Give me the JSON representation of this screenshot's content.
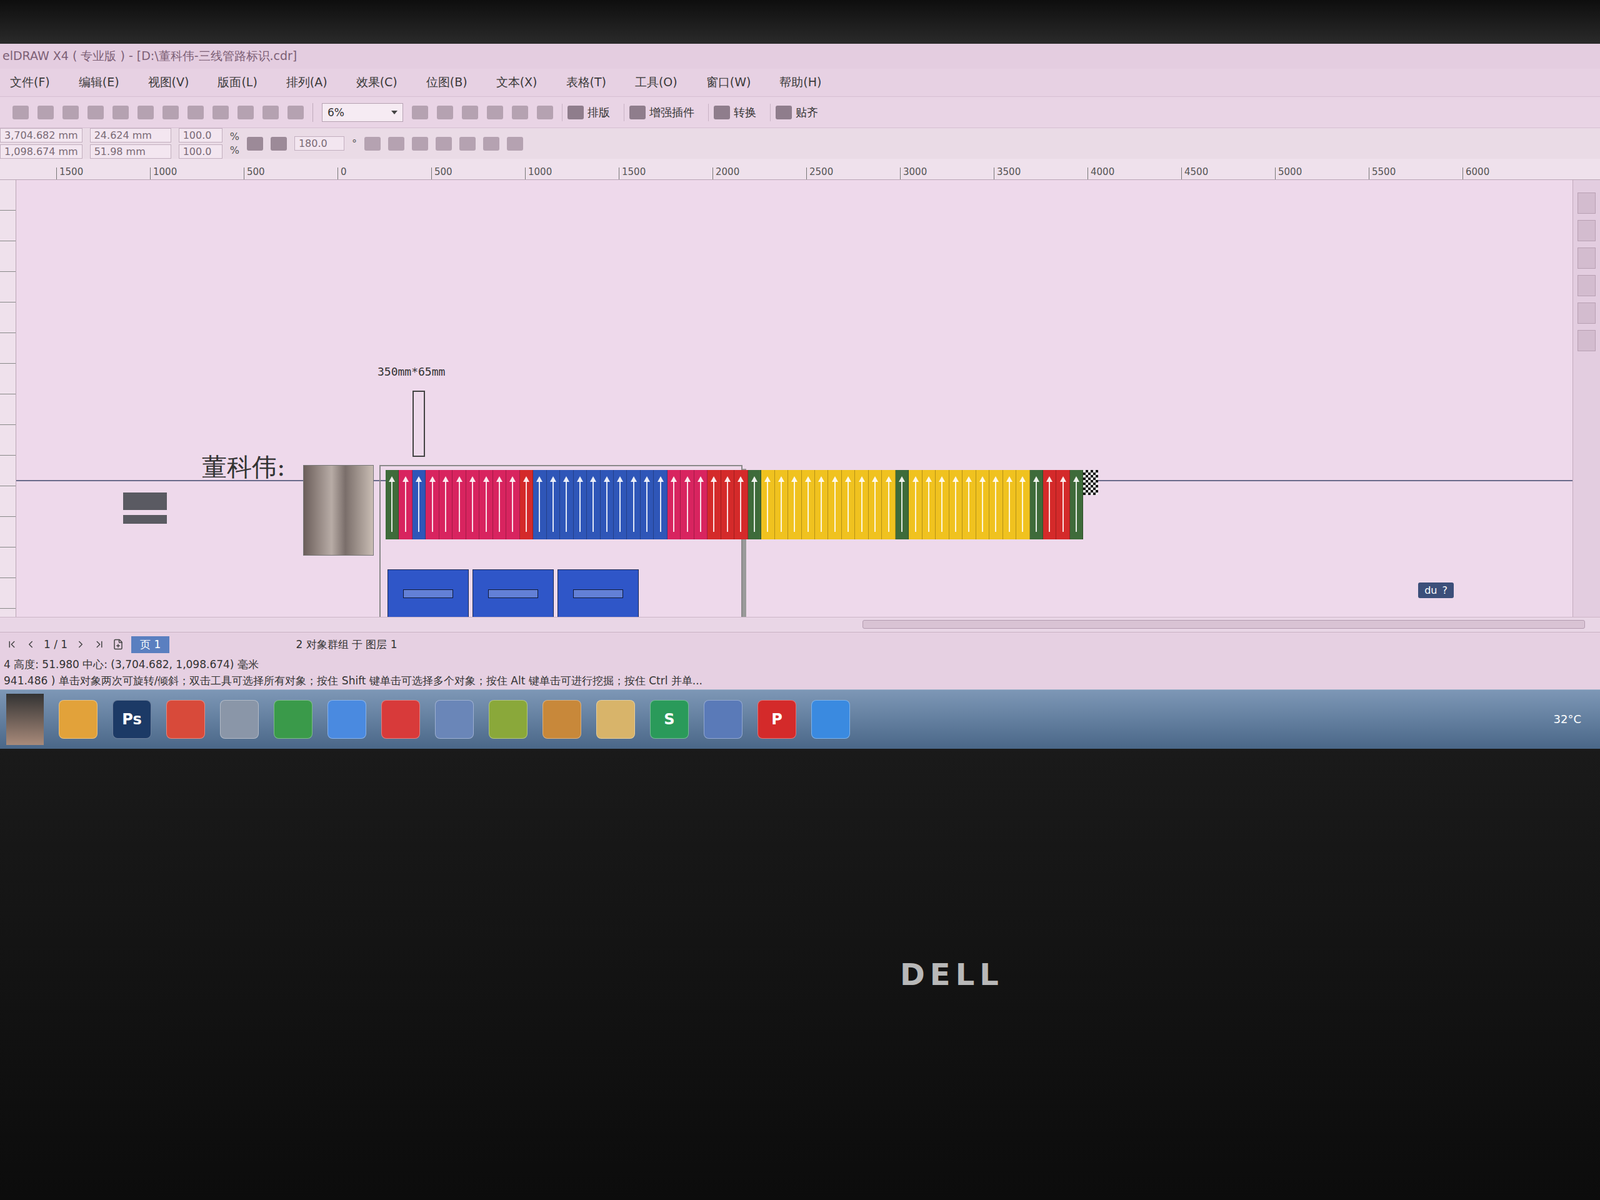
{
  "window": {
    "title": "elDRAW X4 ( 专业版 ) - [D:\\董科伟-三线管路标识.cdr]"
  },
  "menu": [
    "文件(F)",
    "编辑(E)",
    "视图(V)",
    "版面(L)",
    "排列(A)",
    "效果(C)",
    "位图(B)",
    "文本(X)",
    "表格(T)",
    "工具(O)",
    "窗口(W)",
    "帮助(H)"
  ],
  "toolbar": {
    "zoom": "6%",
    "buttons": [
      "排版",
      "增强插件",
      "转换",
      "贴齐"
    ]
  },
  "property_bar": {
    "x": "3,704.682 mm",
    "y": "1,098.674 mm",
    "width": "24.624 mm",
    "height": "51.98 mm",
    "scale_x": "100.0",
    "scale_y": "100.0",
    "percent": "%",
    "rotation": "180.0",
    "degree": "°"
  },
  "ruler": [
    "1500",
    "1000",
    "500",
    "0",
    "500",
    "1000",
    "1500",
    "2000",
    "2500",
    "3000",
    "3500",
    "4000",
    "4500",
    "5000",
    "5500",
    "6000"
  ],
  "canvas": {
    "dimension_label": "350mm*65mm",
    "name_label": "董科伟:",
    "strip": [
      {
        "color": "#3e6b3a"
      },
      {
        "color": "#d8245f"
      },
      {
        "color": "#2f56b8"
      },
      {
        "color": "#d8245f"
      },
      {
        "color": "#d8245f"
      },
      {
        "color": "#d8245f"
      },
      {
        "color": "#d8245f"
      },
      {
        "color": "#d8245f"
      },
      {
        "color": "#d8245f"
      },
      {
        "color": "#d8245f"
      },
      {
        "color": "#d42a2a"
      },
      {
        "color": "#2f56b8"
      },
      {
        "color": "#2f56b8"
      },
      {
        "color": "#2f56b8"
      },
      {
        "color": "#2f56b8"
      },
      {
        "color": "#2f56b8"
      },
      {
        "color": "#2f56b8"
      },
      {
        "color": "#2f56b8"
      },
      {
        "color": "#2f56b8"
      },
      {
        "color": "#2f56b8"
      },
      {
        "color": "#2f56b8"
      },
      {
        "color": "#d8245f"
      },
      {
        "color": "#d8245f"
      },
      {
        "color": "#d8245f"
      },
      {
        "color": "#d42a2a"
      },
      {
        "color": "#d42a2a"
      },
      {
        "color": "#d42a2a"
      },
      {
        "color": "#3e6b3a"
      },
      {
        "color": "#f0c21f"
      },
      {
        "color": "#f0c21f"
      },
      {
        "color": "#f0c21f"
      },
      {
        "color": "#f0c21f"
      },
      {
        "color": "#f0c21f"
      },
      {
        "color": "#f0c21f"
      },
      {
        "color": "#f0c21f"
      },
      {
        "color": "#f0c21f"
      },
      {
        "color": "#f0c21f"
      },
      {
        "color": "#f0c21f"
      },
      {
        "color": "#3e6b3a"
      },
      {
        "color": "#f0c21f"
      },
      {
        "color": "#f0c21f"
      },
      {
        "color": "#f0c21f"
      },
      {
        "color": "#f0c21f"
      },
      {
        "color": "#f0c21f"
      },
      {
        "color": "#f0c21f"
      },
      {
        "color": "#f0c21f"
      },
      {
        "color": "#f0c21f"
      },
      {
        "color": "#f0c21f"
      },
      {
        "color": "#3e6b3a"
      },
      {
        "color": "#d42a2a"
      },
      {
        "color": "#d42a2a"
      },
      {
        "color": "#3e6b3a"
      }
    ],
    "boxes": [
      {
        "color": "#2f56c8"
      },
      {
        "color": "#2f56c8"
      },
      {
        "color": "#2f56c8"
      }
    ],
    "circles": [
      {
        "color": "#e8c02a"
      },
      {
        "color": "#e8c02a"
      },
      {
        "color": "#e8c02a"
      },
      {
        "color": "#2f4a3a"
      },
      {
        "color": "#2f4a3a"
      },
      {
        "color": "#2f4a3a"
      },
      {
        "color": "#2f4a3a"
      },
      {
        "color": "#3a5fcf"
      },
      {
        "color": "#3a5fcf"
      },
      {
        "color": "#3a5fcf"
      },
      {
        "color": "#d62a3a"
      },
      {
        "color": "#d62a3a"
      },
      {
        "color": "#d62a3a"
      },
      {
        "color": "#e8c02a"
      },
      {
        "color": "#e8c02a"
      },
      {
        "color": "#e8c02a"
      },
      {
        "color": "#e8c02a"
      },
      {
        "color": "#2f4a3a"
      },
      {
        "color": "#2f4a3a"
      },
      {
        "color": "#2f4a3a"
      },
      {
        "color": "#3a5fcf"
      },
      {
        "color": "#3a5fcf"
      },
      {
        "color": "#3a5fcf"
      },
      {
        "color": "#3a5fcf"
      },
      {
        "color": "#d62a3a"
      },
      {
        "color": "#d62a3a"
      },
      {
        "color": "#d62a3a"
      },
      {
        "color": "#e8c02a"
      },
      {
        "color": "#e8c02a"
      },
      {
        "color": "#e8c02a"
      },
      {
        "color": "#e8c02a"
      },
      {
        "color": "#2f4a3a"
      },
      {
        "color": "#2f4a3a"
      },
      {
        "color": "#2f4a3a"
      },
      {
        "color": "#2f4a3a"
      },
      {
        "color": "#3a5fcf"
      },
      {
        "color": "#3a5fcf"
      },
      {
        "color": "#3a5fcf"
      },
      {
        "color": "#3a5fcf"
      },
      {
        "color": "#d62a3a"
      },
      {
        "color": "#d62a3a"
      },
      {
        "color": "#d62a3a"
      },
      {
        "color": "#d62a3a"
      },
      {
        "color": "#e8c02a"
      },
      {
        "color": "#e8c02a"
      },
      {
        "color": "#e8c02a"
      },
      {
        "color": "#2f4a3a"
      },
      {
        "color": "#2f4a3a"
      },
      {
        "color": "#2f4a3a"
      },
      {
        "color": "#3a5fcf"
      },
      {
        "color": "#3a5fcf"
      },
      {
        "color": "#d62a3a"
      },
      {
        "color": "#d62a3a"
      },
      {
        "color": "#d62a3a"
      }
    ],
    "widget": {
      "label": "du",
      "help": "?"
    }
  },
  "page_nav": {
    "pages": "1 / 1",
    "tab": "页 1"
  },
  "status_bar": {
    "object": "2 对象群组 于 图层 1",
    "coords": "4 高度: 51.980  中心: (3,704.682, 1,098.674)  毫米",
    "hint": "941.486 ) 单击对象两次可旋转/倾斜；双击工具可选择所有对象；按住 Shift 键单击可选择多个对象；按住 Alt 键单击可进行挖掘；按住 Ctrl 并单..."
  },
  "taskbar": {
    "items": [
      {
        "label": "",
        "color": "#e2a23a"
      },
      {
        "label": "Ps",
        "color": "#1c3a66"
      },
      {
        "label": "",
        "color": "#d84a3a"
      },
      {
        "label": "",
        "color": "#8a96a8"
      },
      {
        "label": "",
        "color": "#3a9a4a"
      },
      {
        "label": "",
        "color": "#4a8ae0"
      },
      {
        "label": "",
        "color": "#d83a3a"
      },
      {
        "label": "",
        "color": "#6a86b8"
      },
      {
        "label": "",
        "color": "#8aa83a"
      },
      {
        "label": "",
        "color": "#c8883a"
      },
      {
        "label": "",
        "color": "#d8b46a"
      },
      {
        "label": "S",
        "color": "#2a9a5a"
      },
      {
        "label": "",
        "color": "#5a7ab8"
      },
      {
        "label": "P",
        "color": "#d42a2a"
      },
      {
        "label": "",
        "color": "#3a8ae0"
      }
    ],
    "weather": "32°C"
  },
  "monitor": {
    "brand": "DELL"
  }
}
